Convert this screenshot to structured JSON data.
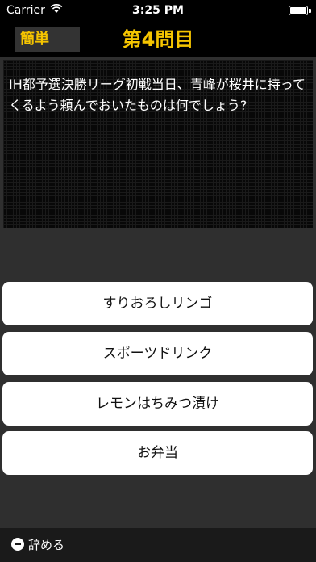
{
  "status_bar": {
    "carrier": "Carrier",
    "time": "3:25 PM",
    "wifi_icon": "wifi-icon",
    "battery_icon": "battery-icon"
  },
  "header": {
    "difficulty": "簡単",
    "title": "第4問目"
  },
  "question": {
    "text": "IH都予選決勝リーグ初戦当日、青峰が桜井に持ってくるよう頼んでおいたものは何でしょう?"
  },
  "answers": [
    {
      "label": "すりおろしリンゴ"
    },
    {
      "label": "スポーツドリンク"
    },
    {
      "label": "レモンはちみつ漬け"
    },
    {
      "label": "お弁当"
    }
  ],
  "footer": {
    "quit_icon": "minus-circle-icon",
    "quit_label": "辞める"
  },
  "colors": {
    "accent": "#f6c500",
    "background": "#2f2f2f",
    "answer_background": "#ffffff"
  }
}
